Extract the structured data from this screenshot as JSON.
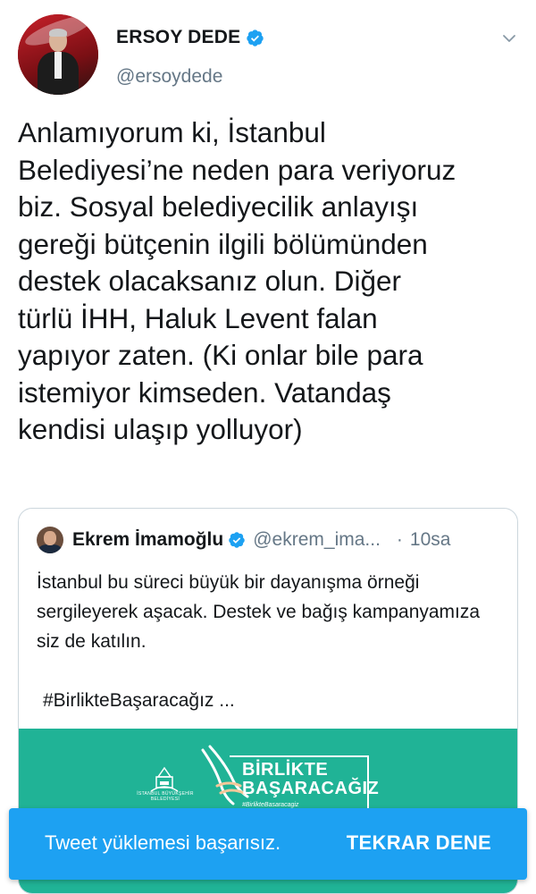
{
  "author": {
    "name": "ERSOY DEDE",
    "handle": "@ersoydede",
    "verified": true
  },
  "tweet": {
    "text": "Anlamıyorum ki, İstanbul\nBelediyesi’ne neden para veriyoruz\nbiz. Sosyal belediyecilik anlayışı\ngereği bütçenin ilgili bölümünden\ndestek olacaksanız olun. Diğer\ntürlü İHH, Haluk Levent falan\nyapıyor zaten. (Ki onlar bile para\nistemiyor kimseden. Vatandaş\nkendisi ulaşıp yolluyor)"
  },
  "quoted_tweet": {
    "name": "Ekrem İmamoğlu",
    "handle": "@ekrem_ima...",
    "separator": "·",
    "time": "10sa",
    "text": "İstanbul bu süreci büyük bir dayanışma örneği sergileyerek aşacak. Destek ve bağış kampanyamıza siz de katılın.",
    "hashtag": "#BirlikteBaşaracağız ...",
    "banner": {
      "logo_text": "İSTANBUL BÜYÜKŞEHİR BELEDİYESİ",
      "title_line1": "BİRLİKTE",
      "title_line2": "BAŞARACAĞIZ",
      "tag": "#BirlikteBasaracagiz"
    }
  },
  "toast": {
    "message": "Tweet yüklemesi başarısız.",
    "action": "TEKRAR DENE"
  },
  "colors": {
    "accent": "#1da1f2",
    "banner": "#20b396",
    "secondary_text": "#657786"
  },
  "icons": [
    "verified-badge-icon",
    "chevron-down-icon"
  ]
}
